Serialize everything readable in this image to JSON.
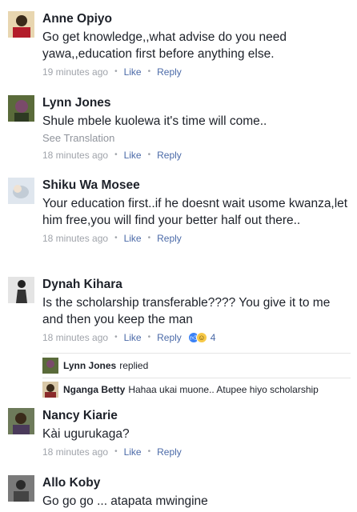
{
  "comments": [
    {
      "author": "Anne Opiyo",
      "text": "Go get knowledge,,what advise do you need yawa,,education first before anything else.",
      "time": "19 minutes ago",
      "like": "Like",
      "reply": "Reply"
    },
    {
      "author": "Lynn Jones",
      "text": "Shule mbele kuolewa it's time will come..",
      "translation": "See Translation",
      "time": "18 minutes ago",
      "like": "Like",
      "reply": "Reply"
    },
    {
      "author": "Shiku Wa Mosee",
      "text": "Your education first..if he doesnt wait usome kwanza,let him free,you will find your better half out there..",
      "time": "18 minutes ago",
      "like": "Like",
      "reply": "Reply"
    },
    {
      "author": "Dynah Kihara",
      "text": "Is the scholarship transferable???? You give it to me and then you keep the man",
      "time": "18 minutes ago",
      "like": "Like",
      "reply": "Reply",
      "reaction_count": "4"
    },
    {
      "author": "Nancy Kiarie",
      "text": "Kài ugurukaga?",
      "time": "18 minutes ago",
      "like": "Like",
      "reply": "Reply"
    },
    {
      "author": "Allo Koby",
      "text": "Go go go ... atapata mwingine"
    }
  ],
  "replies": [
    {
      "author": "Lynn Jones",
      "text": "replied"
    },
    {
      "author": "Nganga Betty",
      "text": "Hahaa ukai muone.. Atupee hiyo scholarship"
    }
  ],
  "colors": {
    "link": "#4b6aa8",
    "meta": "#90949c",
    "text": "#1d2129"
  }
}
